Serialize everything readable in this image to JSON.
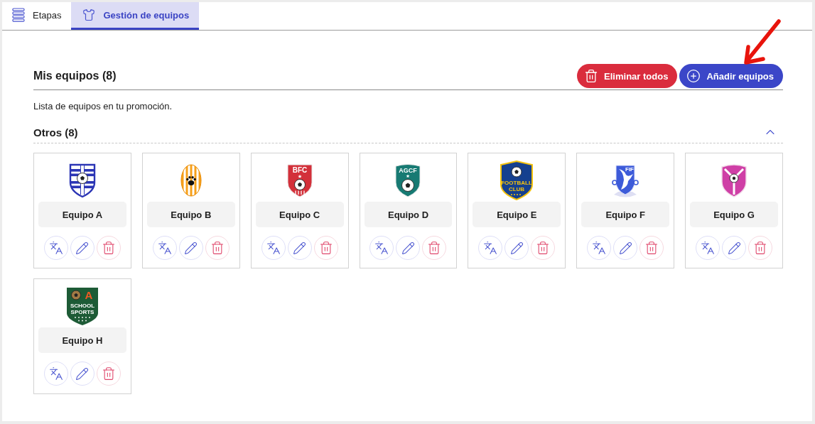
{
  "tabs": [
    {
      "label": "Etapas",
      "kind": "list",
      "selected": false
    },
    {
      "label": "Gestión de equipos",
      "kind": "shirt",
      "selected": true
    }
  ],
  "header": {
    "title": "Mis equipos (8)",
    "buttons": [
      {
        "label": "Eliminar todos",
        "kind": "danger"
      },
      {
        "label": "Añadir equipos",
        "kind": "primary"
      }
    ]
  },
  "description": "Lista de equipos en tu promoción.",
  "group": {
    "title": "Otros (8)",
    "expanded": true,
    "teams": [
      {
        "name": "Equipo A",
        "kind": "striped-shield"
      },
      {
        "name": "Equipo B",
        "kind": "paw-oval"
      },
      {
        "name": "Equipo C",
        "kind": "star-shield",
        "crest_text": [
          "BFC"
        ]
      },
      {
        "name": "Equipo D",
        "kind": "round-shield",
        "crest_text": [
          "AGCF"
        ]
      },
      {
        "name": "Equipo E",
        "kind": "club-shield",
        "crest_text": [
          "FOOTBALL",
          "CLUB"
        ]
      },
      {
        "name": "Equipo F",
        "kind": "wing-shield",
        "crest_text": [
          "FIF"
        ]
      },
      {
        "name": "Equipo G",
        "kind": "y-shield"
      },
      {
        "name": "Equipo H",
        "kind": "school-shield",
        "crest_text": [
          "A",
          "SCHOOL",
          "SPORTS"
        ]
      }
    ]
  },
  "annotations": [
    {
      "kind": "arrow"
    }
  ]
}
